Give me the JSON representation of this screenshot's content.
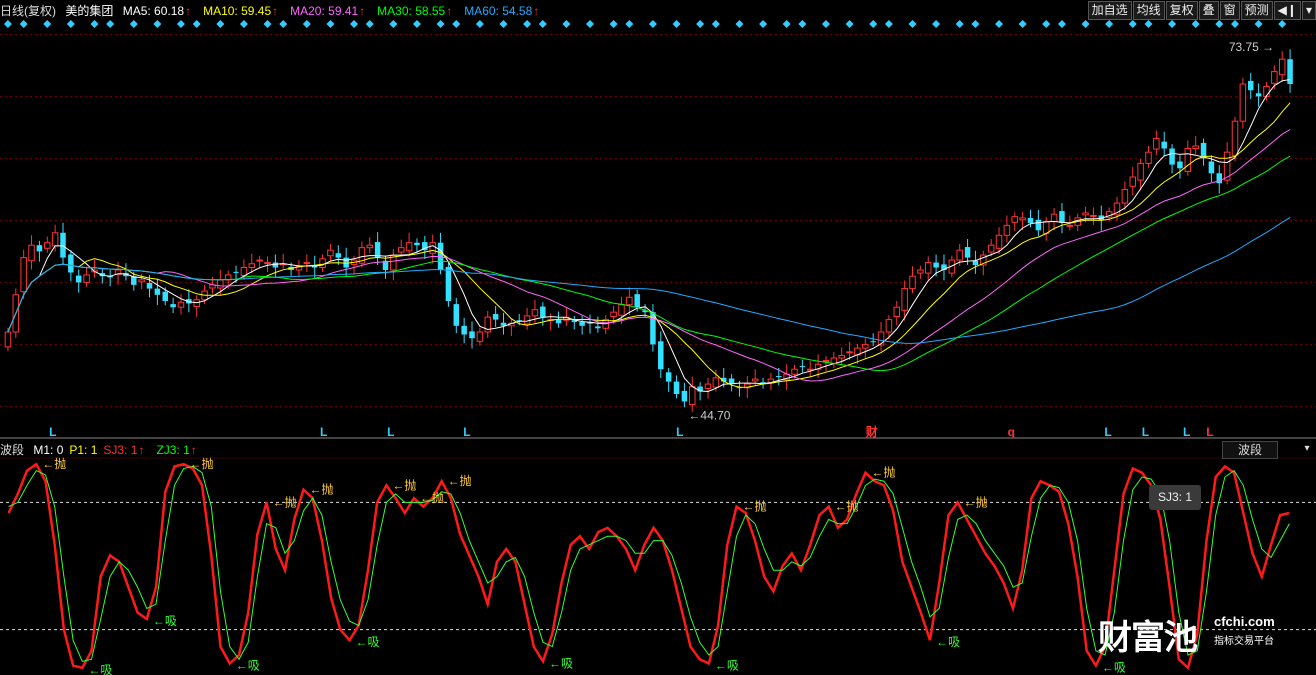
{
  "header": {
    "title": "日线(复权)",
    "stock_name": "美的集团",
    "ma": [
      {
        "label": "MA5: 60.18",
        "color": "#ffffff"
      },
      {
        "label": "MA10: 59.45",
        "color": "#ffff00"
      },
      {
        "label": "MA20: 59.41",
        "color": "#ff66ff"
      },
      {
        "label": "MA30: 58.55",
        "color": "#00ff00"
      },
      {
        "label": "MA60: 54.58",
        "color": "#22aaff"
      }
    ]
  },
  "toolbar": {
    "add_watch": "加自选",
    "ma_lines": "均线",
    "fuquan": "复权",
    "overlay": "叠",
    "window": "窗",
    "predict": "预测",
    "prev_icon": "step-back-icon",
    "menu_icon": "chevron-down-icon"
  },
  "sub_header": {
    "name": "波段",
    "items": [
      {
        "label": "M1: 0",
        "color": "#ffffff",
        "arrow": false
      },
      {
        "label": "P1: 1",
        "color": "#ffff00",
        "arrow": false
      },
      {
        "label": "SJ3: 1",
        "color": "#ff3030",
        "arrow": true
      },
      {
        "label": "ZJ3: 1",
        "color": "#00ff00",
        "arrow": true
      }
    ]
  },
  "sub_selector": "波段",
  "tooltip": "SJ3: 1",
  "logo": {
    "text": "财富池",
    "domain": "cfchi.com",
    "slogan": "指标交易平台"
  },
  "colors": {
    "up": "#ff3333",
    "down": "#33e0ff",
    "bg": "#000000",
    "grid": "#7a0000",
    "ma5": "#ffffff",
    "ma10": "#ffff00",
    "ma20": "#ff66ff",
    "ma30": "#00ff00",
    "ma60": "#22aaff",
    "sj3": "#ff1a1a",
    "zj3": "#33ff33"
  },
  "chart_data": [
    {
      "type": "candlestick",
      "title": "美的集团",
      "ylim": [
        43.5,
        76.0
      ],
      "grid": true,
      "max_label": "73.75",
      "min_label": "44.70",
      "close": [
        51.0,
        54.0,
        57.0,
        58.0,
        57.5,
        58.2,
        59.0,
        57.0,
        55.8,
        55.0,
        55.6,
        56.0,
        55.5,
        55.4,
        56.0,
        55.5,
        54.8,
        55.2,
        54.5,
        54.0,
        53.5,
        53.0,
        53.4,
        53.3,
        53.6,
        54.3,
        54.8,
        55.2,
        55.6,
        55.8,
        56.2,
        56.5,
        56.8,
        56.6,
        56.2,
        56.5,
        56.0,
        56.3,
        56.6,
        56.2,
        56.9,
        57.6,
        57.0,
        56.2,
        56.8,
        57.8,
        58.0,
        57.0,
        56.0,
        57.2,
        57.8,
        58.2,
        58.0,
        57.6,
        58.2,
        56.0,
        53.5,
        51.5,
        50.8,
        50.5,
        51.0,
        52.2,
        52.0,
        51.5,
        51.7,
        51.9,
        52.3,
        52.8,
        52.2,
        52.0,
        51.7,
        52.2,
        51.8,
        51.5,
        51.7,
        51.3,
        52.0,
        52.6,
        53.2,
        53.8,
        53.0,
        52.6,
        50.0,
        48.0,
        47.0,
        46.0,
        45.4,
        46.6,
        46.2,
        46.8,
        47.3,
        47.0,
        46.8,
        46.5,
        46.8,
        47.2,
        46.9,
        47.2,
        47.4,
        47.6,
        48.0,
        48.2,
        48.0,
        48.4,
        48.7,
        48.9,
        49.1,
        49.4,
        49.7,
        50.0,
        50.2,
        51.0,
        52.0,
        53.0,
        54.5,
        55.5,
        56.0,
        56.6,
        56.2,
        56.0,
        56.8,
        57.6,
        57.0,
        56.4,
        57.2,
        58.0,
        58.8,
        59.6,
        60.3,
        60.2,
        59.8,
        59.2,
        59.9,
        60.5,
        59.8,
        59.6,
        60.2,
        60.6,
        60.4,
        60.0,
        60.7,
        61.4,
        62.5,
        63.5,
        64.6,
        65.5,
        66.6,
        65.8,
        64.5,
        64.2,
        65.8,
        66.0,
        65.0,
        63.8,
        63.0,
        65.5,
        68.0,
        71.0,
        70.5,
        70.0,
        70.8,
        72.0,
        73.0,
        71.0
      ],
      "annotations": [
        {
          "text": "L"
        },
        {
          "text": "L"
        },
        {
          "text": "L"
        },
        {
          "text": "L"
        },
        {
          "text": "L"
        },
        {
          "text": "财"
        },
        {
          "text": "q"
        },
        {
          "text": "L"
        },
        {
          "text": "L"
        },
        {
          "text": "L"
        },
        {
          "text": "L"
        }
      ]
    },
    {
      "type": "line",
      "title": "波段",
      "ylim": [
        0,
        100
      ],
      "levels": [
        80,
        20
      ],
      "series": [
        {
          "name": "SJ3",
          "values": [
            75,
            84,
            95,
            98,
            90,
            60,
            20,
            3,
            2,
            10,
            45,
            55,
            52,
            40,
            28,
            25,
            40,
            85,
            97,
            98,
            96,
            88,
            55,
            12,
            4,
            8,
            28,
            65,
            80,
            58,
            48,
            72,
            86,
            82,
            62,
            35,
            20,
            15,
            22,
            48,
            80,
            88,
            82,
            75,
            82,
            78,
            82,
            90,
            82,
            65,
            55,
            45,
            32,
            52,
            58,
            52,
            32,
            12,
            5,
            18,
            42,
            60,
            64,
            58,
            66,
            68,
            64,
            58,
            48,
            60,
            68,
            62,
            48,
            30,
            12,
            6,
            4,
            22,
            60,
            78,
            75,
            62,
            45,
            38,
            50,
            56,
            48,
            60,
            74,
            78,
            68,
            72,
            84,
            94,
            90,
            88,
            76,
            52,
            40,
            28,
            15,
            42,
            74,
            80,
            72,
            64,
            56,
            50,
            42,
            30,
            48,
            82,
            90,
            88,
            85,
            70,
            45,
            10,
            3,
            12,
            48,
            84,
            96,
            94,
            88,
            72,
            40,
            6,
            2,
            18,
            62,
            92,
            97,
            94,
            75,
            56,
            45,
            60,
            74,
            75
          ]
        },
        {
          "name": "ZJ3",
          "values": [
            78,
            80,
            88,
            95,
            93,
            78,
            45,
            15,
            5,
            6,
            25,
            45,
            52,
            48,
            40,
            30,
            32,
            62,
            88,
            96,
            97,
            94,
            78,
            38,
            12,
            6,
            14,
            45,
            70,
            68,
            56,
            62,
            76,
            82,
            74,
            52,
            34,
            24,
            22,
            34,
            60,
            80,
            84,
            80,
            80,
            80,
            81,
            85,
            84,
            75,
            62,
            52,
            42,
            45,
            52,
            54,
            45,
            28,
            14,
            12,
            28,
            48,
            58,
            60,
            62,
            64,
            64,
            62,
            56,
            56,
            62,
            62,
            55,
            42,
            26,
            14,
            8,
            12,
            38,
            64,
            74,
            70,
            58,
            48,
            48,
            52,
            50,
            54,
            64,
            72,
            70,
            70,
            78,
            88,
            91,
            90,
            84,
            68,
            52,
            40,
            26,
            30,
            54,
            72,
            74,
            70,
            62,
            56,
            50,
            40,
            42,
            64,
            82,
            88,
            87,
            80,
            62,
            30,
            10,
            8,
            28,
            62,
            86,
            92,
            91,
            84,
            62,
            28,
            8,
            10,
            38,
            74,
            92,
            95,
            88,
            72,
            58,
            54,
            62,
            70
          ]
        }
      ],
      "labels": [
        {
          "text": "抛"
        },
        {
          "text": "吸"
        },
        {
          "text": "抛"
        },
        {
          "text": "吸"
        },
        {
          "text": "抛"
        },
        {
          "text": "抛"
        },
        {
          "text": "吸"
        },
        {
          "text": "抛"
        },
        {
          "text": "吸"
        },
        {
          "text": "抛"
        },
        {
          "text": "抛"
        },
        {
          "text": "抛"
        },
        {
          "text": "抛"
        },
        {
          "text": "吸"
        },
        {
          "text": "吸"
        },
        {
          "text": "抛"
        },
        {
          "text": "吸"
        },
        {
          "text": "吸"
        },
        {
          "text": "抛"
        }
      ]
    }
  ]
}
